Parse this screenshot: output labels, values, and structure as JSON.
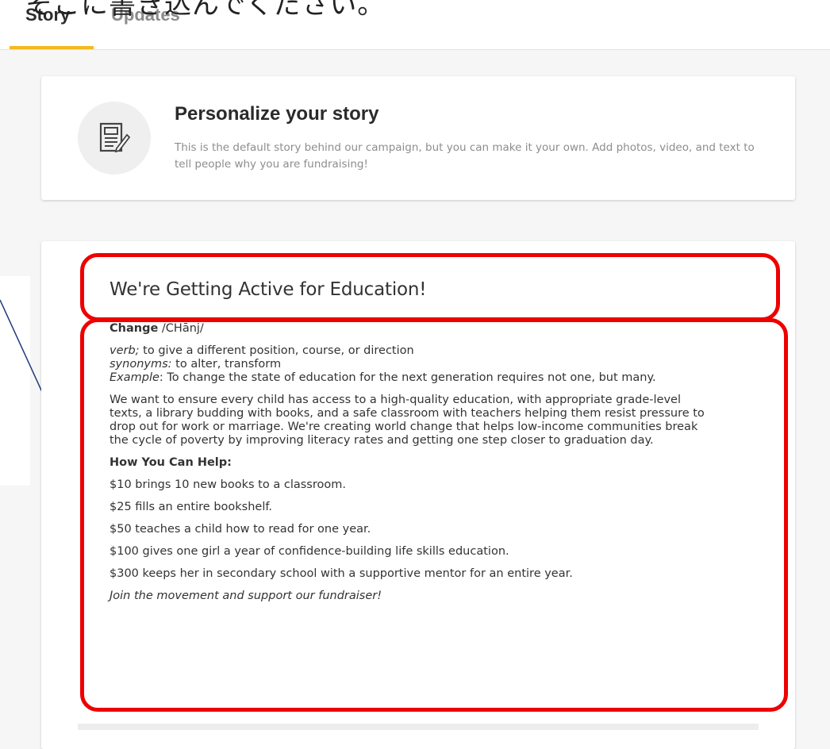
{
  "overlay_text": "そこに書き込んでください。",
  "tabs": [
    {
      "label": "Story"
    },
    {
      "label": "Updates"
    }
  ],
  "personalize": {
    "title": "Personalize your story",
    "description": "This is the default story behind our campaign, but you can make it your own. Add photos, video, and text to tell people why you are fundraising!",
    "icon": "edit-document-icon"
  },
  "story": {
    "title": "We're Getting Active for Education!",
    "word": "Change",
    "pronunciation": " /CHānj/",
    "pos": "verb;",
    "definition": " to give a different position, course, or direction",
    "synonyms_label": "synonyms:",
    "synonyms": " to alter, transform",
    "example_label": "Example",
    "example": ": To change the state of education for the next generation requires not one, but many.",
    "paragraph": "We want to ensure every child has access to a high-quality education, with appropriate grade-level texts, a library budding with books, and a safe classroom with teachers helping them resist pressure to drop out for work or marriage. We're creating world change that helps low-income communities break the cycle of poverty by improving literacy rates and getting one step closer to graduation day.",
    "help_heading": "How You Can Help:",
    "help_items": [
      "$10 brings 10 new books to a classroom.",
      "$25 fills an entire bookshelf.",
      "$50 teaches a child how to read for one year.",
      "$100 gives one girl a year of confidence-building life skills education.",
      "$300 keeps her in secondary school with a supportive mentor for an entire year."
    ],
    "closing": "Join the movement and support our fundraiser!"
  },
  "colors": {
    "tab_underline": "#f5b820",
    "highlight": "#ee0000",
    "arrow": "#1f3a78"
  }
}
